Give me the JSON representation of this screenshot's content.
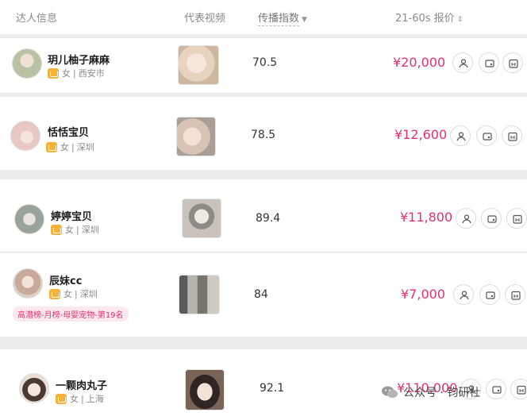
{
  "header": {
    "col_creator": "达人信息",
    "col_video": "代表视频",
    "col_index": "传播指数",
    "col_price": "21-60s 报价",
    "index_sort_icon": "caret-down-icon",
    "price_sort_icon": "sort-updown-icon"
  },
  "rows": [
    {
      "name": "玥儿柚子麻麻",
      "gender": "女",
      "city": "西安市",
      "index": "70.5",
      "price": "¥20,000"
    },
    {
      "name": "恬恬宝贝",
      "gender": "女",
      "city": "深圳",
      "index": "78.5",
      "price": "¥12,600"
    },
    {
      "name": "婷婷宝贝",
      "gender": "女",
      "city": "深圳",
      "index": "89.4",
      "price": "¥11,800"
    },
    {
      "name": "辰妹cc",
      "gender": "女",
      "city": "深圳",
      "index": "84",
      "price": "¥7,000",
      "rank": "高潜榜-月榜-母婴宠物-第19名"
    },
    {
      "name": "一颗肉丸子",
      "gender": "女",
      "city": "上海",
      "index": "92.1",
      "price": "¥110,000"
    }
  ],
  "separator": "|",
  "actions": [
    "person-icon",
    "cart-icon",
    "calendar-icon"
  ],
  "watermark": {
    "text": "公众号 · 钧研社",
    "icon": "wechat-icon"
  },
  "colors": {
    "price": "#e4316f",
    "badge": "#f4b23a",
    "rank_bg": "#fde8ef"
  }
}
